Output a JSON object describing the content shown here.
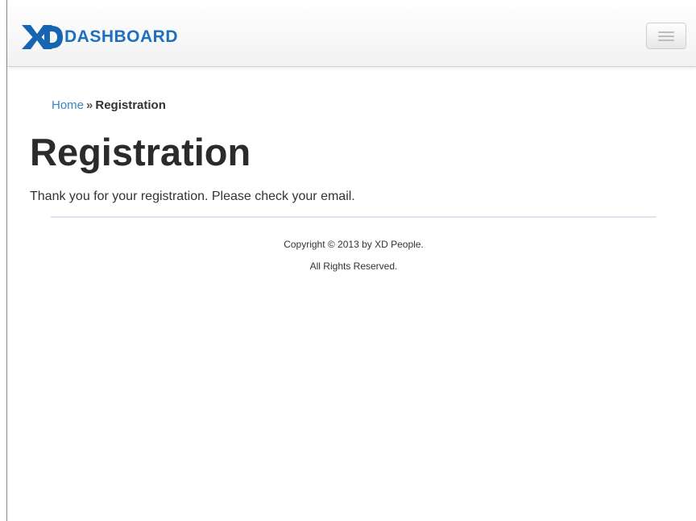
{
  "navbar": {
    "brand_mark": "XD",
    "brand_text": "DASHBOARD",
    "menu_toggle_icon": "hamburger-icon",
    "brand_color": "#1e6fbf"
  },
  "breadcrumb": {
    "home_label": "Home",
    "separator": "»",
    "current_label": "Registration",
    "link_color": "#3a84c9"
  },
  "main": {
    "title": "Registration",
    "message": "Thank you for your registration. Please check your email."
  },
  "footer": {
    "copyright": "Copyright © 2013 by XD People.",
    "rights": "All Rights Reserved."
  }
}
